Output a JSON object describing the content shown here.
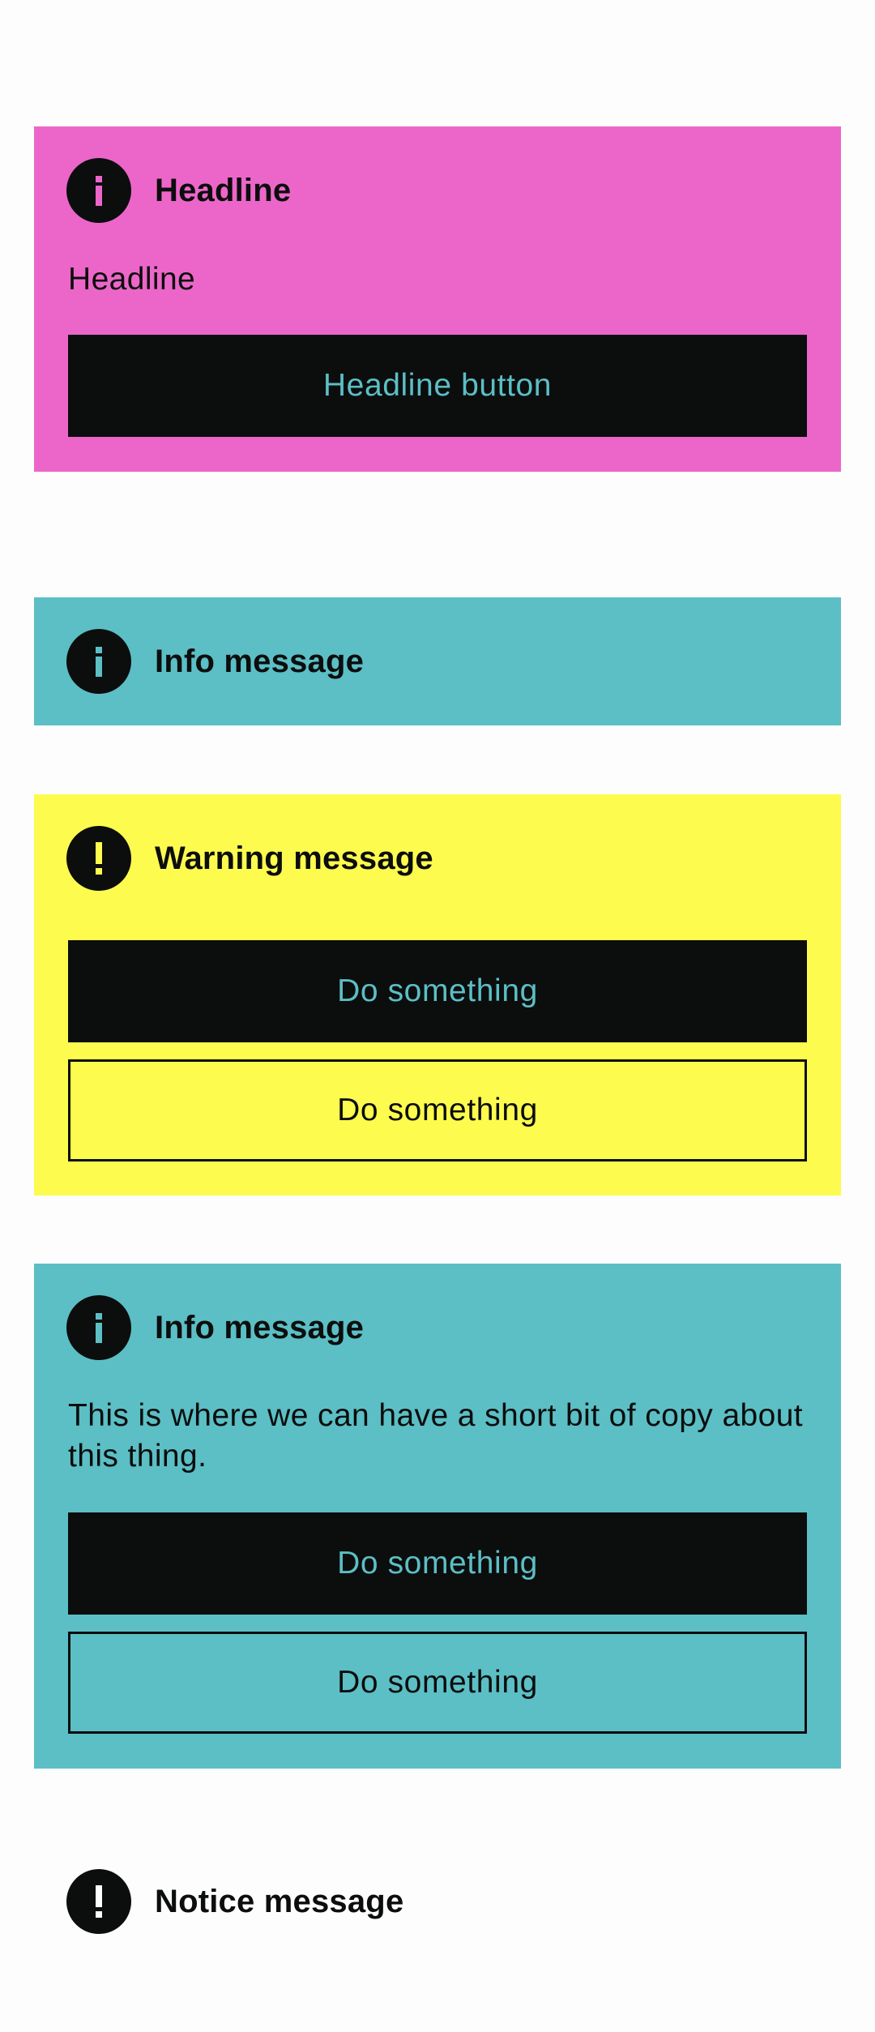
{
  "colors": {
    "magenta": "#ec66c9",
    "teal": "#5bbfc5",
    "yellow": "#fdfc4e",
    "white": "#fdfdfd",
    "ink": "#0c0d0d"
  },
  "banner_headline": {
    "icon": "info-icon",
    "title": "Headline",
    "body": "Headline",
    "button_label": "Headline button"
  },
  "banner_info_simple": {
    "icon": "info-icon",
    "title": "Info message"
  },
  "banner_warning": {
    "icon": "exclamation-icon",
    "title": "Warning message",
    "primary_label": "Do something",
    "secondary_label": "Do something"
  },
  "banner_info_full": {
    "icon": "info-icon",
    "title": "Info message",
    "body": "This is where we can have a short bit of copy about this thing.",
    "primary_label": "Do something",
    "secondary_label": "Do something"
  },
  "banner_notice": {
    "icon": "exclamation-icon",
    "title": "Notice message"
  }
}
